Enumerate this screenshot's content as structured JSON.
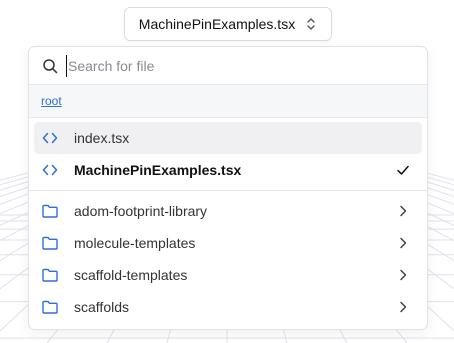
{
  "selector": {
    "current_file": "MachinePinExamples.tsx",
    "icon": "chevron-up-down-icon"
  },
  "search": {
    "placeholder": "Search for file",
    "value": "",
    "icon": "search-icon"
  },
  "breadcrumb": {
    "root_label": "root"
  },
  "files": [
    {
      "name": "index.tsx",
      "icon": "code-icon",
      "hovered": true,
      "selected": false
    },
    {
      "name": "MachinePinExamples.tsx",
      "icon": "code-icon",
      "hovered": false,
      "selected": true,
      "trail_icon": "check-icon"
    }
  ],
  "folders": [
    {
      "name": "adom-footprint-library",
      "icon": "folder-icon",
      "trail_icon": "chevron-right-icon"
    },
    {
      "name": "molecule-templates",
      "icon": "folder-icon",
      "trail_icon": "chevron-right-icon"
    },
    {
      "name": "scaffold-templates",
      "icon": "folder-icon",
      "trail_icon": "chevron-right-icon"
    },
    {
      "name": "scaffolds",
      "icon": "folder-icon",
      "trail_icon": "chevron-right-icon"
    }
  ],
  "colors": {
    "accent": "#2f6fd6",
    "hover_bg": "#f0f0f2",
    "breadcrumb_bg": "#f6f7f9"
  }
}
